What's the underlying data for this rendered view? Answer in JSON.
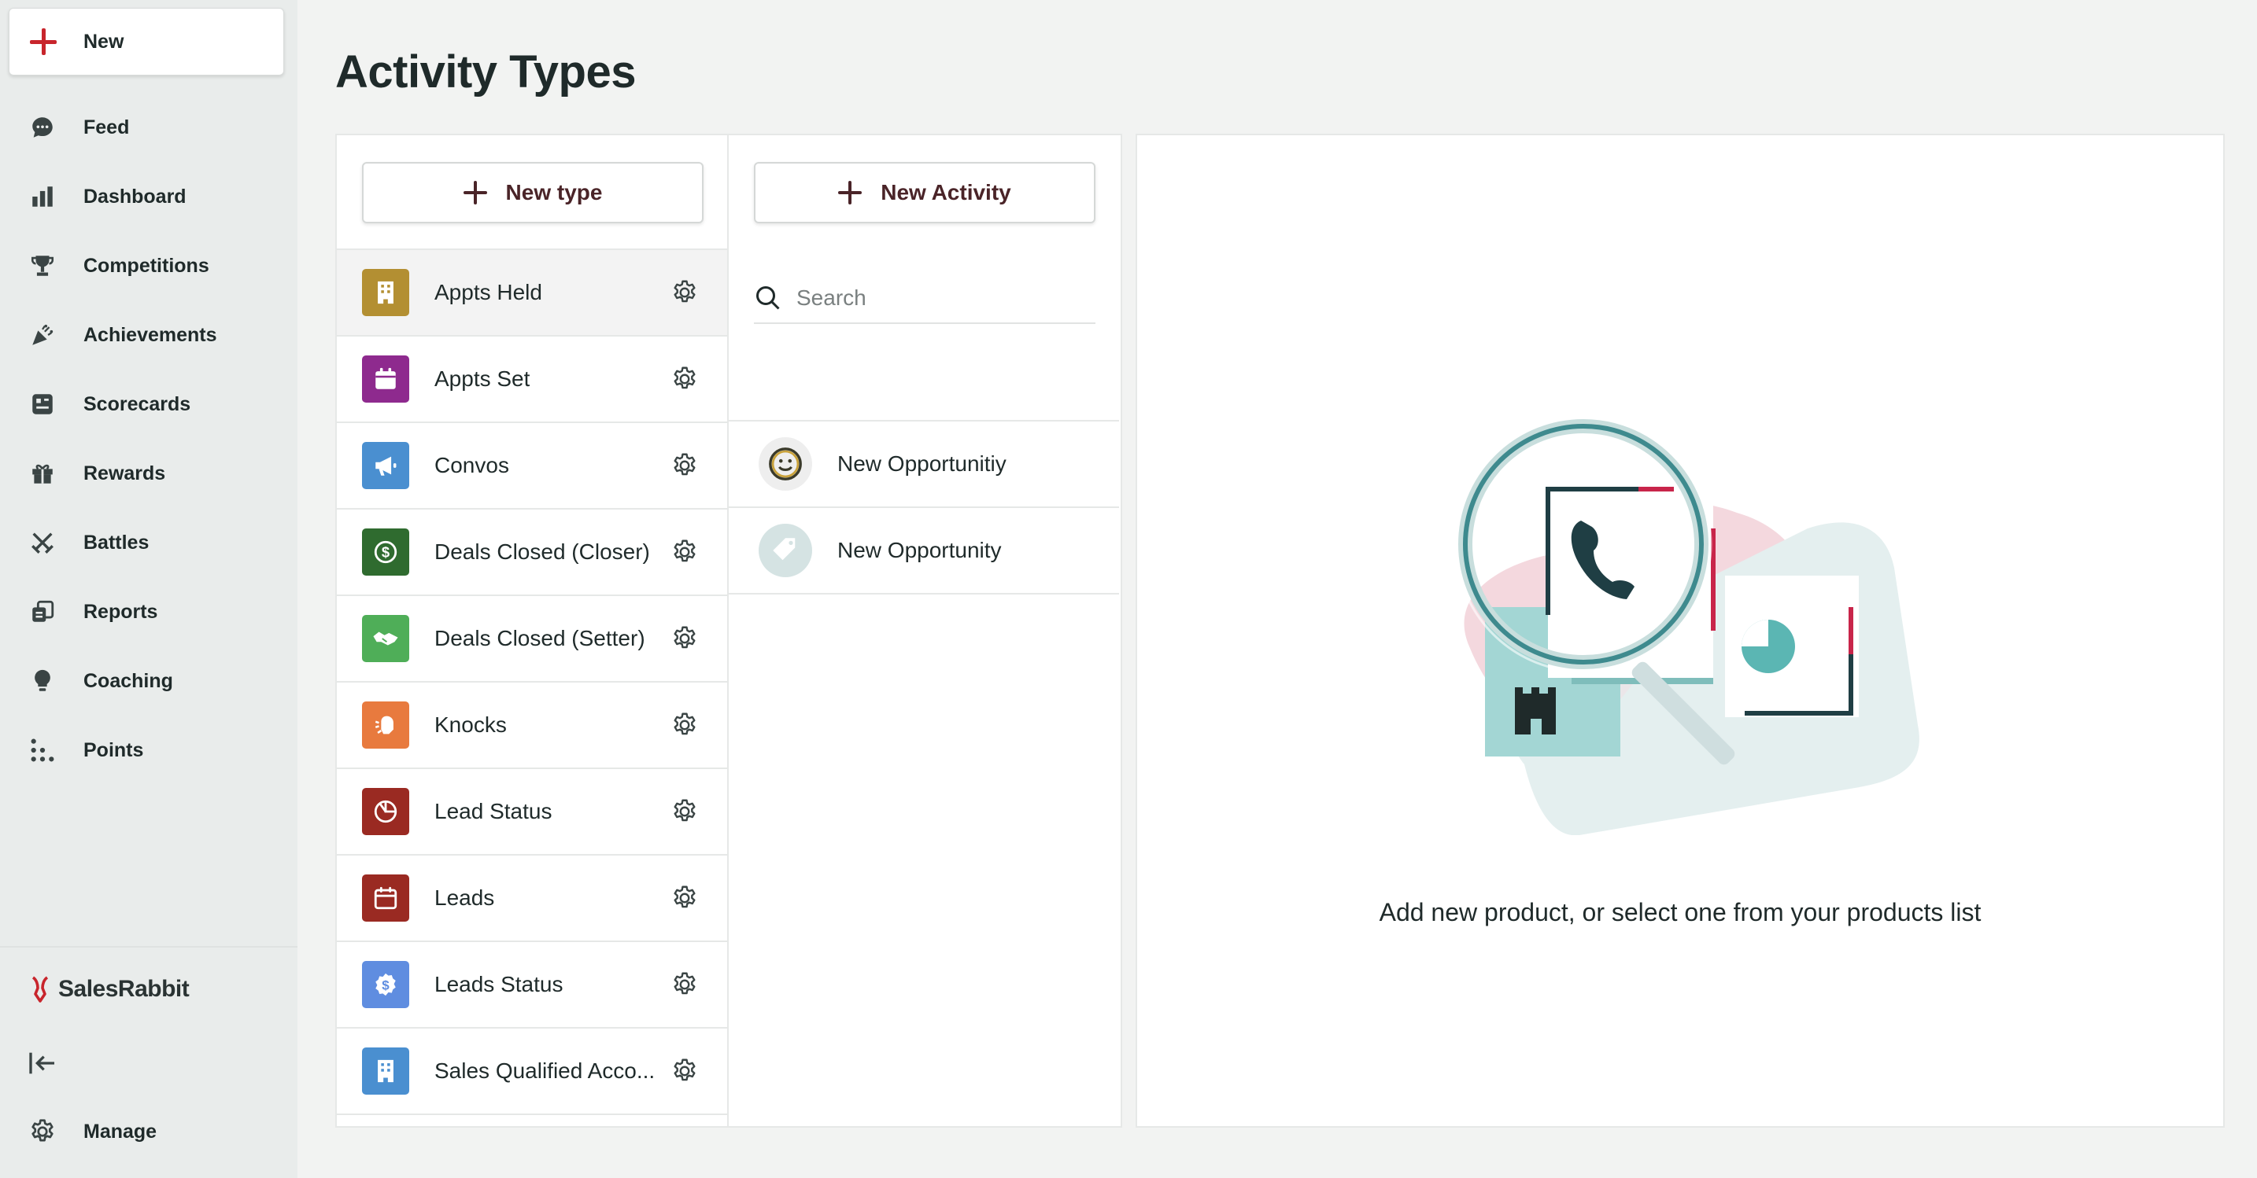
{
  "sidebar": {
    "new_label": "New",
    "items": [
      {
        "label": "Feed",
        "icon": "chat-bubble-icon"
      },
      {
        "label": "Dashboard",
        "icon": "bar-chart-icon"
      },
      {
        "label": "Competitions",
        "icon": "trophy-icon"
      },
      {
        "label": "Achievements",
        "icon": "party-popper-icon"
      },
      {
        "label": "Scorecards",
        "icon": "scorecard-icon"
      },
      {
        "label": "Rewards",
        "icon": "gift-icon"
      },
      {
        "label": "Battles",
        "icon": "crossed-swords-icon"
      },
      {
        "label": "Reports",
        "icon": "reports-icon"
      },
      {
        "label": "Coaching",
        "icon": "lightbulb-icon"
      },
      {
        "label": "Points",
        "icon": "dots-grid-icon"
      }
    ],
    "brand": "SalesRabbit",
    "manage_label": "Manage",
    "brand_color": "#c8252c"
  },
  "page": {
    "title": "Activity Types"
  },
  "types_panel": {
    "new_type_label": "New type",
    "items": [
      {
        "name": "Appts Held",
        "color": "#b38f32",
        "icon": "building-icon",
        "selected": true
      },
      {
        "name": "Appts Set",
        "color": "#8e2a8e",
        "icon": "calendar-icon"
      },
      {
        "name": "Convos",
        "color": "#4a8fd0",
        "icon": "megaphone-icon"
      },
      {
        "name": "Deals Closed (Closer)",
        "color": "#2f6b2f",
        "icon": "dollar-circle-icon"
      },
      {
        "name": "Deals Closed (Setter)",
        "color": "#4fae58",
        "icon": "handshake-icon"
      },
      {
        "name": "Knocks",
        "color": "#e87a3e",
        "icon": "hand-knock-icon"
      },
      {
        "name": "Lead Status",
        "color": "#9a2a22",
        "icon": "pie-chart-icon"
      },
      {
        "name": "Leads",
        "color": "#9a2a22",
        "icon": "calendar-outline-icon"
      },
      {
        "name": "Leads Status",
        "color": "#5f8de0",
        "icon": "dollar-badge-icon"
      },
      {
        "name": "Sales Qualified Acco...",
        "color": "#4a8fd0",
        "icon": "building-icon"
      }
    ]
  },
  "activities_panel": {
    "new_activity_label": "New Activity",
    "search_placeholder": "Search",
    "items": [
      {
        "name": "New Opportunitiy",
        "icon": "smiley-face-icon",
        "bg": "#eeeeee"
      },
      {
        "name": "New Opportunity",
        "icon": "tag-icon",
        "bg": "#d5e3e3"
      }
    ]
  },
  "detail_panel": {
    "empty_message": "Add new product, or select one from your products list"
  }
}
